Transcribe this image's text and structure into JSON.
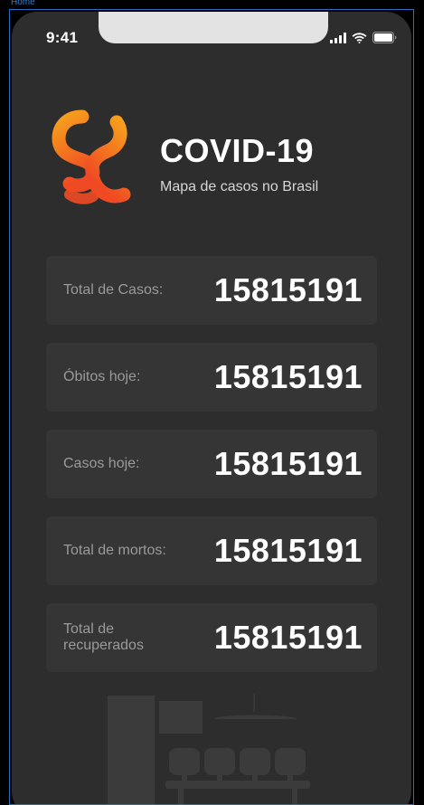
{
  "frame": {
    "label": "Home"
  },
  "status_bar": {
    "time": "9:41",
    "icons": [
      "cellular-signal-icon",
      "wifi-icon",
      "battery-icon"
    ]
  },
  "header": {
    "logo_icon": "covid-logo-icon",
    "title": "COVID-19",
    "subtitle": "Mapa de casos no Brasil"
  },
  "stats": [
    {
      "label": "Total de Casos:",
      "value": "15815191"
    },
    {
      "label": "Óbitos hoje:",
      "value": "15815191"
    },
    {
      "label": "Casos hoje:",
      "value": "15815191"
    },
    {
      "label": "Total de mortos:",
      "value": "15815191"
    },
    {
      "label": "Total de recuperados",
      "value": "15815191"
    }
  ],
  "colors": {
    "background": "#2d2d2d",
    "card": "#353535",
    "logo_gradient_start": "#f7a11c",
    "logo_gradient_end": "#ef4a23",
    "frame_outline": "#2b6cc4"
  },
  "illustration": {
    "icon": "waiting-room-illustration-icon"
  }
}
